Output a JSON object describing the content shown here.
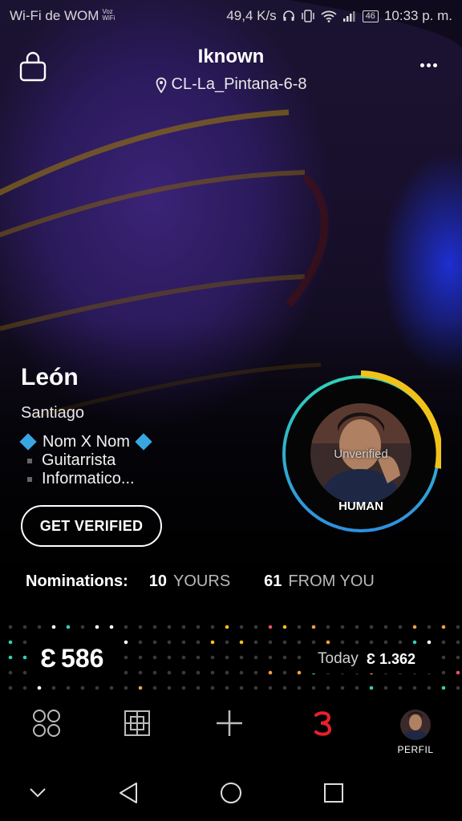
{
  "status_bar": {
    "carrier": "Wi-Fi de WOM",
    "voz_top": "Voz",
    "voz_bottom": "WiFi",
    "speed": "49,4 K/s",
    "battery": "46",
    "time": "10:33 p. m."
  },
  "header": {
    "title": "Iknown",
    "location": "CL-La_Pintana-6-8"
  },
  "profile": {
    "name": "León",
    "city": "Santiago",
    "bio_line1": "Nom X Nom",
    "bio_line2": "Guitarrista",
    "bio_line3": "Informatico...",
    "verify_button": "GET VERIFIED",
    "avatar_status": "Unverified",
    "avatar_type": "HUMAN"
  },
  "nominations": {
    "label": "Nominations:",
    "yours_count": "10",
    "yours_label": "YOURS",
    "from_you_count": "61",
    "from_you_label": "FROM YOU"
  },
  "score": {
    "symbol": "Ɛ",
    "value": "586",
    "today_label": "Today",
    "today_value": "Ɛ 1.362"
  },
  "tabbar": {
    "perfil_label": "PERFIL"
  },
  "colors": {
    "ring_teal": "#2fd1b8",
    "ring_blue": "#2f8fe0",
    "ring_yellow": "#f2c21a",
    "accent_red": "#e8202a",
    "diamond_blue": "#39a6e0"
  }
}
